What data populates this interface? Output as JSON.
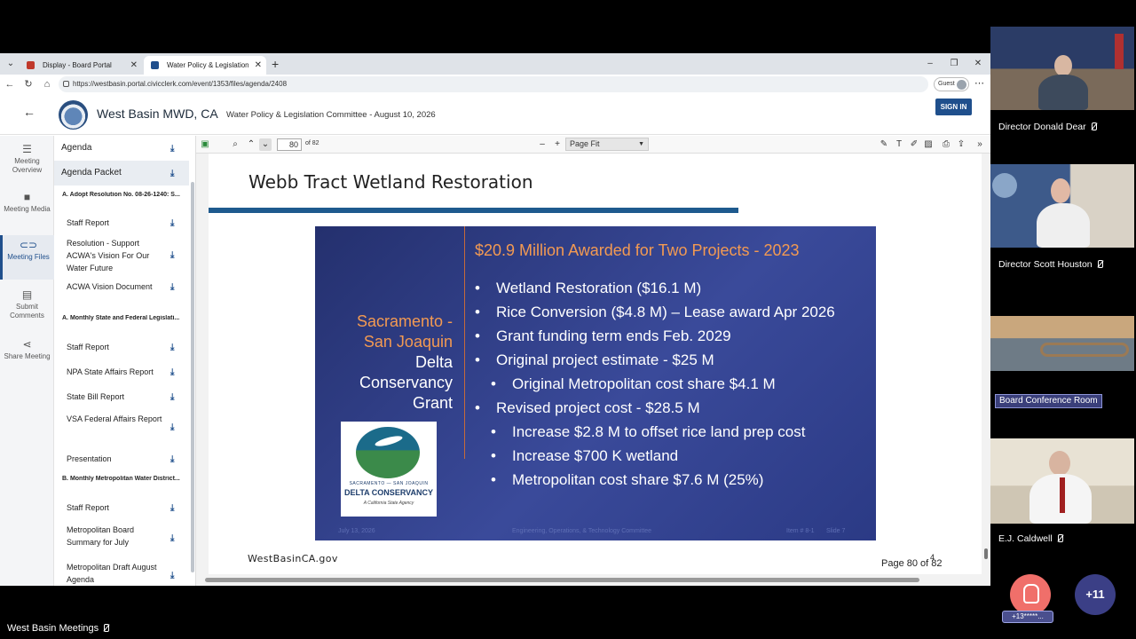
{
  "browser": {
    "tabs": [
      {
        "title": "Display - Board Portal"
      },
      {
        "title": "Water Policy & Legislation Committee"
      }
    ],
    "url": "https://westbasin.portal.civicclerk.com/event/1353/files/agenda/2408",
    "profile_label": "Guest"
  },
  "site": {
    "name": "West Basin MWD, CA",
    "event_title": "Water Policy & Legislation Committee - August 10, 2026",
    "sign_in": "SIGN IN"
  },
  "rail": [
    {
      "label": "Meeting Overview",
      "icon": "list-icon"
    },
    {
      "label": "Meeting Media",
      "icon": "video-icon"
    },
    {
      "label": "Meeting Files",
      "icon": "link-icon"
    },
    {
      "label": "Submit Comments",
      "icon": "comment-icon"
    },
    {
      "label": "Share Meeting",
      "icon": "share-icon"
    }
  ],
  "files": {
    "top": [
      "Agenda",
      "Agenda Packet"
    ],
    "section_a": "A. Adopt Resolution No. 08-26-1240: S...",
    "a_items": [
      "Staff Report",
      "Resolution - Support ACWA's Vision For Our Water Future",
      "ACWA Vision Document"
    ],
    "section_a2": "A. Monthly State and Federal Legislati...",
    "a2_items": [
      "Staff Report",
      "NPA State Affairs Report",
      "State Bill Report",
      "VSA Federal Affairs Report",
      "Presentation"
    ],
    "section_b": "B. Monthly Metropolitan Water District...",
    "b_items": [
      "Staff Report",
      "Metropolitan Board Summary for July",
      "Metropolitan Draft August Agenda"
    ]
  },
  "viewer": {
    "page_current": "80",
    "page_total": "of 82",
    "zoom": "Page Fit"
  },
  "pdf": {
    "title": "Webb Tract Wetland Restoration",
    "slide": {
      "left_orange": [
        "Sacramento -",
        "San Joaquin"
      ],
      "left_white": [
        "Delta",
        "Conservancy",
        "Grant"
      ],
      "logo": {
        "top": "SACRAMENTO — SAN JOAQUIN",
        "main": "DELTA CONSERVANCY",
        "sub": "A California State Agency"
      },
      "heading": "$20.9 Million Awarded for Two Projects - 2023",
      "bullets": [
        {
          "level": 1,
          "text": "Wetland Restoration ($16.1 M)"
        },
        {
          "level": 1,
          "text": "Rice Conversion ($4.8 M) – Lease award Apr 2026"
        },
        {
          "level": 1,
          "text": "Grant funding term ends Feb. 2029"
        },
        {
          "level": 1,
          "text": "Original project estimate - $25 M"
        },
        {
          "level": 2,
          "text": "Original Metropolitan cost share $4.1 M"
        },
        {
          "level": 1,
          "text": "Revised project cost - $28.5 M"
        },
        {
          "level": 2,
          "text": "Increase $2.8 M to offset rice land prep cost"
        },
        {
          "level": 2,
          "text": "Increase $700 K wetland"
        },
        {
          "level": 2,
          "text": "Metropolitan cost share $7.6 M (25%)"
        }
      ],
      "footer": {
        "date": "July 13, 2026",
        "committee": "Engineering, Operations, & Technology Committee",
        "item": "Item # 8-1",
        "slide_no": "Slide 7"
      }
    },
    "footer_left": "WestBasinCA.gov",
    "footer_right": "Page 80 of 82",
    "footer_num": "4"
  },
  "participants": [
    {
      "name": "Director Donald Dear"
    },
    {
      "name": "Director Scott Houston"
    },
    {
      "name": "Board Conference Room"
    },
    {
      "name": "E.J. Caldwell"
    }
  ],
  "meeting": {
    "title": "West Basin Meetings",
    "raise_count": "+13*****...",
    "more_count": "+11"
  }
}
